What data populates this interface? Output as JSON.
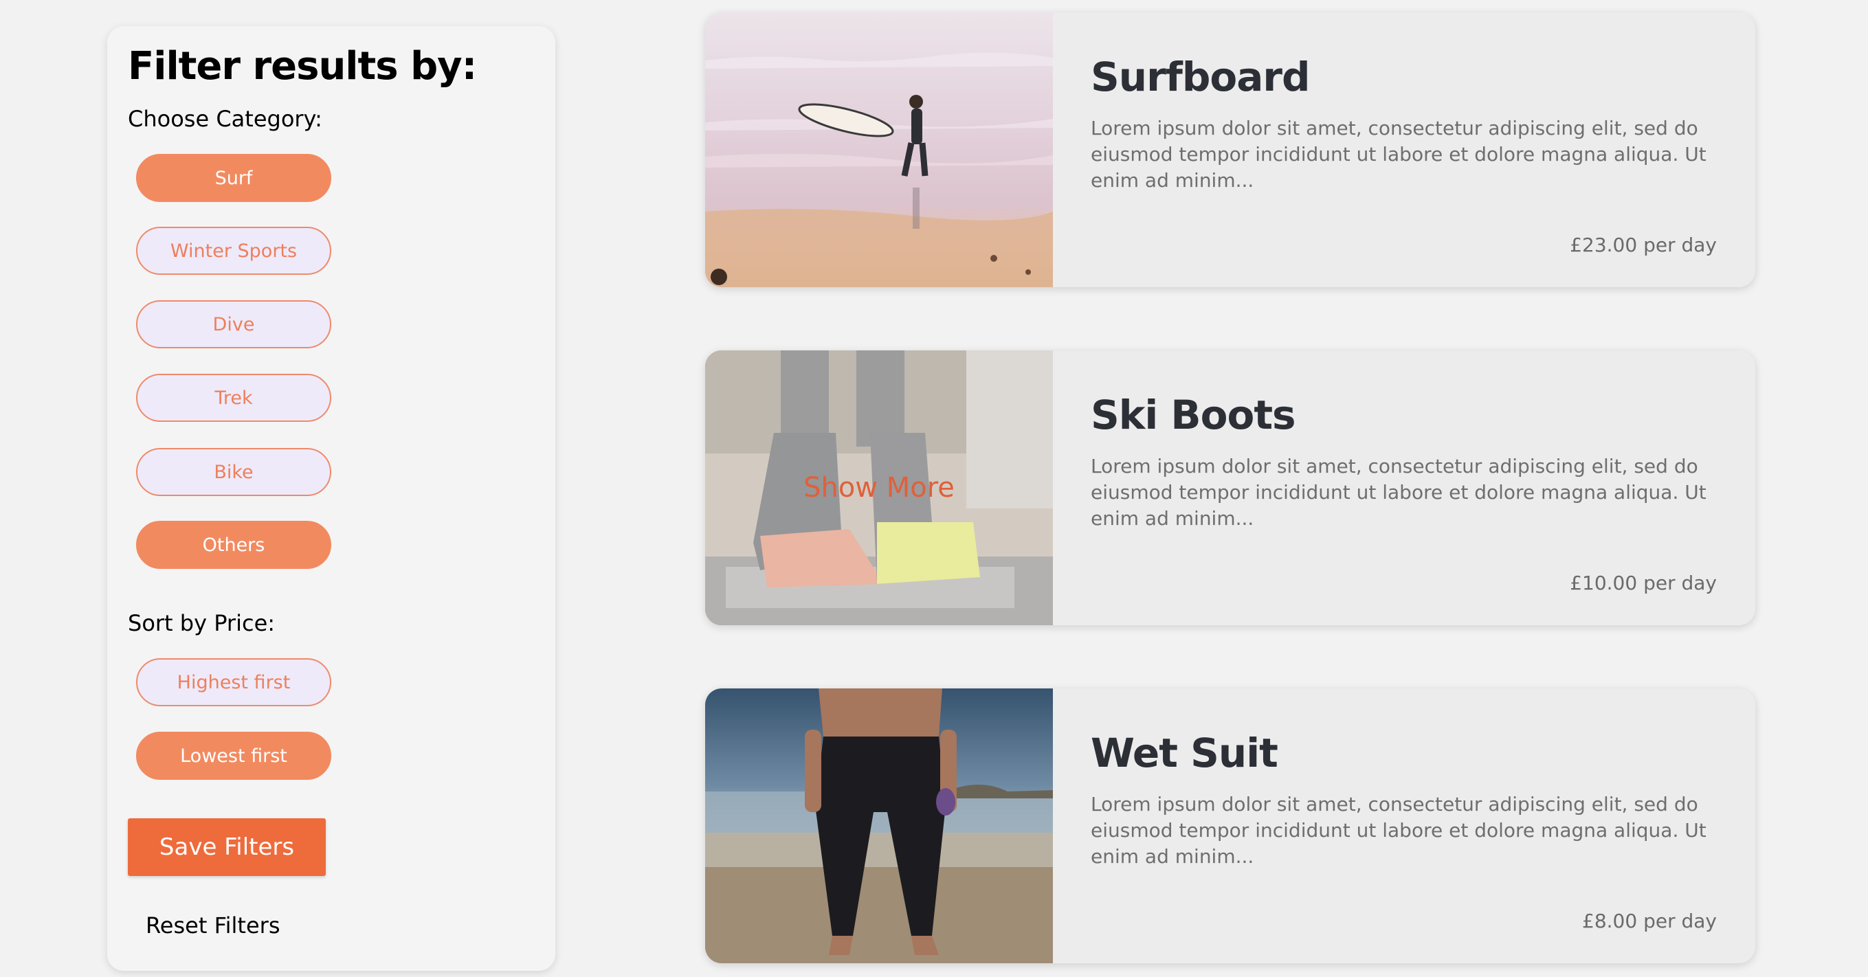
{
  "filters": {
    "title": "Filter results by:",
    "category_label": "Choose Category:",
    "categories": [
      {
        "label": "Surf",
        "active": true
      },
      {
        "label": "Winter Sports",
        "active": false
      },
      {
        "label": "Dive",
        "active": false
      },
      {
        "label": "Trek",
        "active": false
      },
      {
        "label": "Bike",
        "active": false
      },
      {
        "label": "Others",
        "active": true
      }
    ],
    "sort_label": "Sort by Price:",
    "sort_options": [
      {
        "label": "Highest first",
        "active": false
      },
      {
        "label": "Lowest first",
        "active": true
      }
    ],
    "save_label": "Save Filters",
    "reset_label": "Reset Filters"
  },
  "products": [
    {
      "title": "Surfboard",
      "description": "Lorem ipsum dolor sit amet, consectetur adipiscing elit, sed do eiusmod tempor incididunt ut labore et dolore magna aliqua. Ut enim ad minim...",
      "price": "£23.00 per day",
      "image": "surfer-on-beach-photo"
    },
    {
      "title": "Ski Boots",
      "description": "Lorem ipsum dolor sit amet, consectetur adipiscing elit, sed do eiusmod tempor incididunt ut labore et dolore magna aliqua. Ut enim ad minim...",
      "price": "£10.00 per day",
      "image": "ski-boots-photo",
      "overlay_label": "Show More"
    },
    {
      "title": "Wet Suit",
      "description": "Lorem ipsum dolor sit amet, consectetur adipiscing elit, sed do eiusmod tempor incididunt ut labore et dolore magna aliqua. Ut enim ad minim...",
      "price": "£8.00 per day",
      "image": "wetsuit-diver-photo"
    }
  ],
  "colors": {
    "accent": "#f28a60",
    "save_button": "#ee6b3c",
    "pill_inactive_bg": "#eeeafa",
    "pill_inactive_text": "#ee7f5c",
    "card_bg": "#ececec",
    "page_bg": "#f2f2f2"
  }
}
